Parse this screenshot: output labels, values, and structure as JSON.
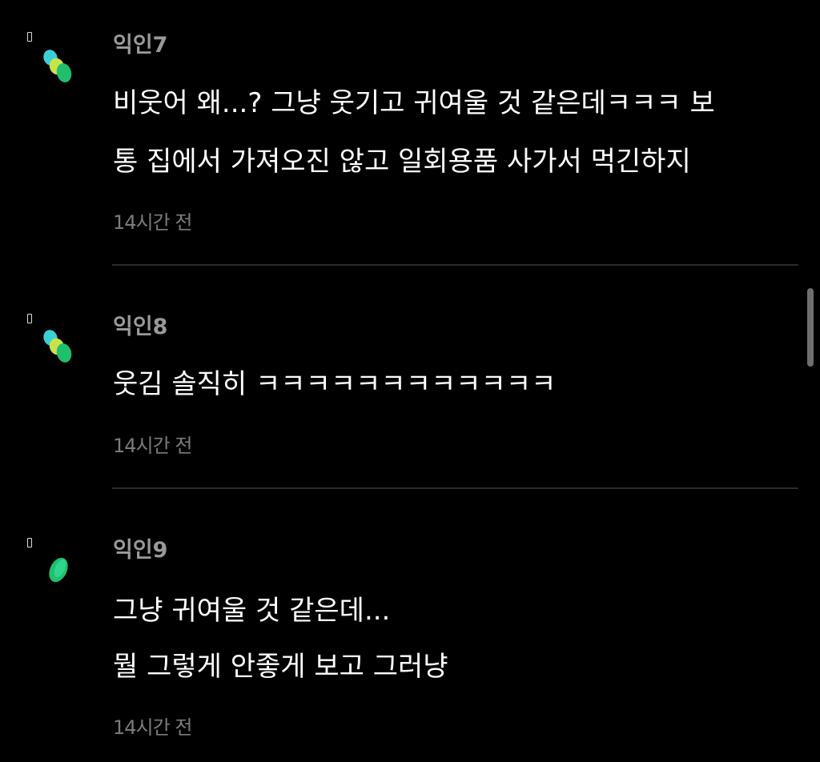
{
  "comments": [
    {
      "author": "익인7",
      "lines": [
        "비웃어 왜...? 그냥 웃기고 귀여울 것 같은데ㅋㅋㅋ 보",
        "통 집에서 가져오진 않고 일회용품 사가서 먹긴하지"
      ],
      "time": "14시간 전",
      "avatar_icon": "cluster-avatar-icon"
    },
    {
      "author": "익인8",
      "lines": [
        "웃김 솔직히 ㅋㅋㅋㅋㅋㅋㅋㅋㅋㅋㅋㅋ"
      ],
      "time": "14시간 전",
      "avatar_icon": "cluster-avatar-icon"
    },
    {
      "author": "익인9",
      "lines": [
        "그냥 귀여울 것 같은데...",
        "뭘 그렇게 안좋게 보고 그러냥"
      ],
      "time": "14시간 전",
      "avatar_icon": "leaf-avatar-icon"
    }
  ],
  "colors": {
    "background": "#000000",
    "author_text": "#9a9a9a",
    "body_text": "#ffffff",
    "time_text": "#7b7b7b",
    "divider": "#2b2b2b",
    "avatar_cyan": "#3ccfd6",
    "avatar_lime": "#c8e34a",
    "avatar_green": "#1fbf6e"
  }
}
